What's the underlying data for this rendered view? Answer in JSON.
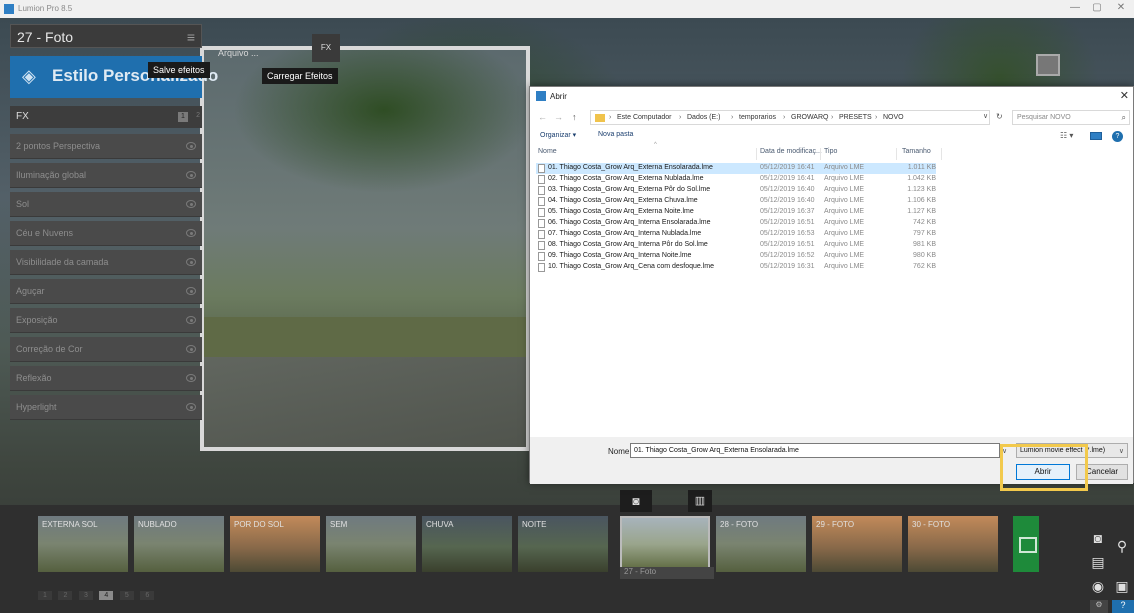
{
  "window": {
    "title": "Lumion Pro 8.5",
    "minimize": "—",
    "maximize": "▢",
    "close": "✕"
  },
  "left_panel": {
    "photo_title": "27 - Foto",
    "menu_icon": "≡",
    "arquivo_label": "Arquivo ...",
    "style_title": "Estilo Personalizado",
    "save_tooltip": "Salve efeitos",
    "load_tooltip": "Carregar Efeitos",
    "fx_label": "FX",
    "fx_page_current": "1",
    "fx_page_next": "2",
    "fx_icon_label": "FX",
    "effects": [
      "2 pontos Perspectiva",
      "Iluminação global",
      "Sol",
      "Céu e Nuvens",
      "Visibilidade da camada",
      "Aguçar",
      "Exposição",
      "Correção de Cor",
      "Reflexão",
      "Hyperlight"
    ]
  },
  "dialog": {
    "title": "Abrir",
    "nav": {
      "back": "←",
      "forward": "→",
      "up": "↑"
    },
    "breadcrumb": [
      "Este Computador",
      "Dados (E:)",
      "temporarios",
      "GROWARQ",
      "PRESETS",
      "NOVO"
    ],
    "search_placeholder": "Pesquisar NOVO",
    "toolbar": {
      "organize": "Organizar ▾",
      "new_folder": "Nova pasta"
    },
    "columns": {
      "name": "Nome",
      "date": "Data de modificaç...",
      "type": "Tipo",
      "size": "Tamanho"
    },
    "files": [
      {
        "name": "01. Thiago Costa_Grow Arq_Externa Ensolarada.lme",
        "date": "05/12/2019 16:41",
        "type": "Arquivo LME",
        "size": "1.011 KB",
        "selected": true
      },
      {
        "name": "02. Thiago Costa_Grow Arq_Externa Nublada.lme",
        "date": "05/12/2019 16:41",
        "type": "Arquivo LME",
        "size": "1.042 KB"
      },
      {
        "name": "03. Thiago Costa_Grow Arq_Externa Pôr do Sol.lme",
        "date": "05/12/2019 16:40",
        "type": "Arquivo LME",
        "size": "1.123 KB"
      },
      {
        "name": "04. Thiago Costa_Grow Arq_Externa Chuva.lme",
        "date": "05/12/2019 16:40",
        "type": "Arquivo LME",
        "size": "1.106 KB"
      },
      {
        "name": "05. Thiago Costa_Grow Arq_Externa Noite.lme",
        "date": "05/12/2019 16:37",
        "type": "Arquivo LME",
        "size": "1.127 KB"
      },
      {
        "name": "06. Thiago Costa_Grow Arq_Interna Ensolarada.lme",
        "date": "05/12/2019 16:51",
        "type": "Arquivo LME",
        "size": "742 KB"
      },
      {
        "name": "07. Thiago Costa_Grow Arq_Interna Nublada.lme",
        "date": "05/12/2019 16:53",
        "type": "Arquivo LME",
        "size": "797 KB"
      },
      {
        "name": "08. Thiago Costa_Grow Arq_Interna Pôr do Sol.lme",
        "date": "05/12/2019 16:51",
        "type": "Arquivo LME",
        "size": "981 KB"
      },
      {
        "name": "09. Thiago Costa_Grow Arq_Interna Noite.lme",
        "date": "05/12/2019 16:52",
        "type": "Arquivo LME",
        "size": "980 KB"
      },
      {
        "name": "10. Thiago Costa_Grow Arq_Cena com desfoque.lme",
        "date": "05/12/2019 16:31",
        "type": "Arquivo LME",
        "size": "762 KB"
      }
    ],
    "filename_label": "Nome:",
    "filename_value": "01. Thiago Costa_Grow Arq_Externa Ensolarada.lme",
    "filetype": "Lumion movie effect (*.lme)",
    "open_button": "Abrir",
    "cancel_button": "Cancelar"
  },
  "bottom": {
    "thumbnails": [
      "EXTERNA SOL",
      "NUBLADO",
      "POR DO SOL",
      "SEM",
      "CHUVA",
      "NOITE",
      "",
      "28 - Foto",
      "29 - Foto",
      "30 - Foto"
    ],
    "selected_thumbnail_label": "27 - Foto",
    "pages": [
      "1",
      "2",
      "3",
      "4",
      "5",
      "6"
    ],
    "current_page": "4",
    "help_label": "?"
  },
  "colors": {
    "accent": "#1f6fae",
    "selection": "#cce8ff",
    "highlight": "#f2c94c",
    "add_button": "#1e8a3a"
  }
}
